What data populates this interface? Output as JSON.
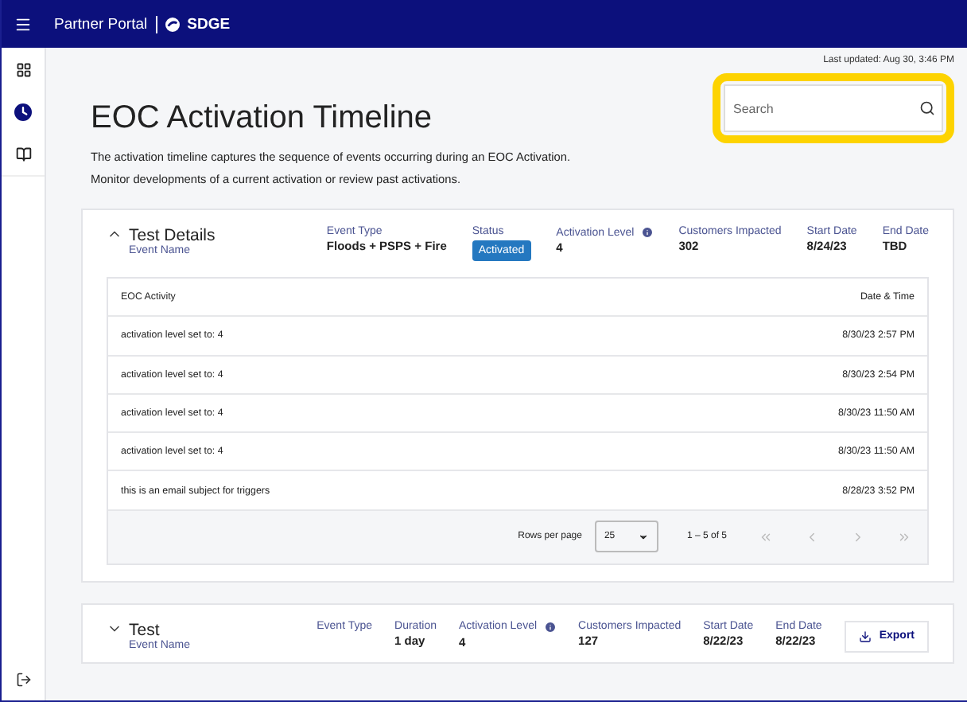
{
  "header": {
    "title": "Partner Portal",
    "brand": "SDGE"
  },
  "sidebar": {
    "items": [
      {
        "kind": "dashboard",
        "selected": false
      },
      {
        "kind": "clock",
        "selected": true
      },
      {
        "kind": "book",
        "selected": false
      }
    ]
  },
  "last_updated": "Last updated: Aug 30, 3:46 PM",
  "page_title": "EOC Activation Timeline",
  "search": {
    "placeholder": "Search",
    "highlighted": true
  },
  "description": [
    "The activation timeline captures the sequence of events occurring during an EOC Activation.",
    "Monitor developments of a current activation or review past activations."
  ],
  "events": [
    {
      "title": "Test Details",
      "subtitle": "Event Name",
      "expanded": true,
      "fields": [
        {
          "label": "Event Type",
          "value": "Floods + PSPS + Fire",
          "kind": "text"
        },
        {
          "label": "Status",
          "value": "Activated",
          "kind": "badge"
        },
        {
          "label": "Activation Level",
          "value": "4",
          "kind": "info"
        },
        {
          "label": "Customers Impacted",
          "value": "302",
          "kind": "text"
        },
        {
          "label": "Start Date",
          "value": "8/24/23",
          "kind": "text"
        },
        {
          "label": "End Date",
          "value": "TBD",
          "kind": "text"
        }
      ],
      "table": {
        "columns": [
          "EOC Activity",
          "Date & Time"
        ],
        "rows": [
          [
            "activation level set to: 4",
            "8/30/23 2:57 PM"
          ],
          [
            "activation level set to: 4",
            "8/30/23 2:54 PM"
          ],
          [
            "activation level set to: 4",
            "8/30/23 11:50 AM"
          ],
          [
            "activation level set to: 4",
            "8/30/23 11:50 AM"
          ],
          [
            "this is an email subject for triggers",
            "8/28/23 3:52 PM"
          ]
        ],
        "rows_per_page_label": "Rows per page",
        "rows_per_page": "25",
        "range": "1 – 5 of 5"
      }
    },
    {
      "title": "Test",
      "subtitle": "Event Name",
      "expanded": false,
      "fields": [
        {
          "label": "Event Type",
          "kind": "text"
        },
        {
          "label": "Duration",
          "value": "1 day",
          "kind": "text"
        },
        {
          "label": "Activation Level",
          "value": "4",
          "kind": "info"
        },
        {
          "label": "Customers Impacted",
          "value": "127",
          "kind": "text"
        },
        {
          "label": "Start Date",
          "value": "8/22/23",
          "kind": "text"
        },
        {
          "label": "End Date",
          "value": "8/22/23",
          "kind": "text"
        }
      ],
      "export": "Export"
    }
  ]
}
